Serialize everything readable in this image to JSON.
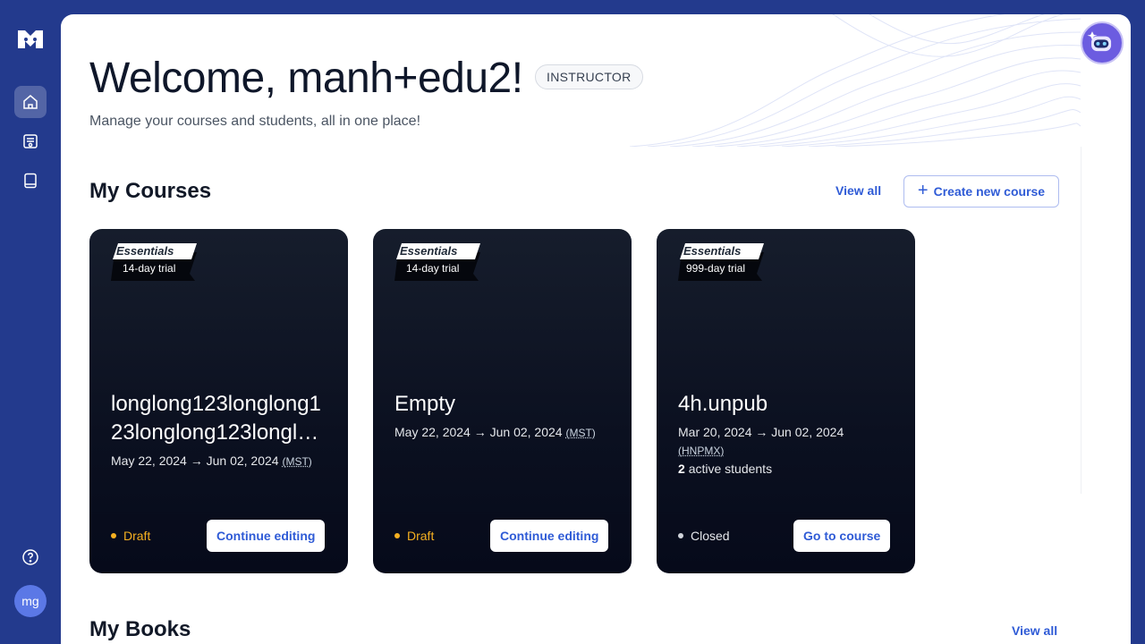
{
  "sidebar": {
    "logo": "brand-logo",
    "items": [
      {
        "name": "home-icon",
        "active": true
      },
      {
        "name": "courses-icon",
        "active": false
      },
      {
        "name": "books-icon",
        "active": false
      }
    ],
    "help_icon": "help-circle-icon",
    "avatar_initials": "mg"
  },
  "header": {
    "welcome": "Welcome, manh+edu2!",
    "role": "INSTRUCTOR",
    "subtitle": "Manage your courses and students, all in one place!"
  },
  "courses_section": {
    "title": "My Courses",
    "view_all": "View all",
    "create_label": "Create new course",
    "courses": [
      {
        "plan": "Essentials",
        "trial": "14-day trial",
        "title": "longlong123longlong123longlong123longl…",
        "dates": "May 22, 2024 → Jun 02, 2024",
        "tz": "(MST)",
        "students_count": "",
        "students_label": "",
        "status": "Draft",
        "status_color": "#f5b021",
        "button": "Continue editing"
      },
      {
        "plan": "Essentials",
        "trial": "14-day trial",
        "title": "Empty",
        "dates": "May 22, 2024 → Jun 02, 2024",
        "tz": "(MST)",
        "students_count": "",
        "students_label": "",
        "status": "Draft",
        "status_color": "#f5b021",
        "button": "Continue editing"
      },
      {
        "plan": "Essentials",
        "trial": "999-day trial",
        "title": "4h.unpub",
        "dates": "Mar 20, 2024 → Jun 02, 2024",
        "tz": "(HNPMX)",
        "students_count": "2",
        "students_label": "active students",
        "status": "Closed",
        "status_color": "#d1d5db",
        "button": "Go to course"
      }
    ]
  },
  "books_section": {
    "title": "My Books",
    "view_all": "View all"
  },
  "assistant": {
    "icon": "robot-assistant-icon"
  },
  "colors": {
    "brand": "#233a8d",
    "accent": "#2f5bd6",
    "card": "#0b1020"
  }
}
